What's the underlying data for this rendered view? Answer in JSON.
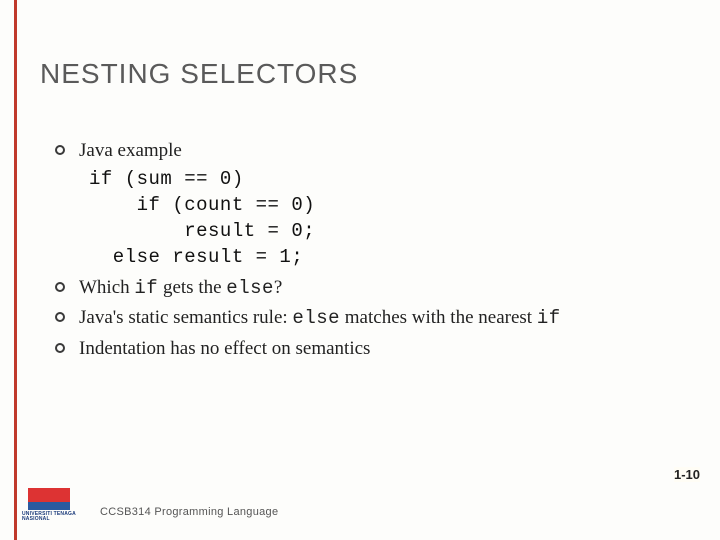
{
  "title": "NESTING SELECTORS",
  "bullets": {
    "b1": "Java example",
    "code_lines": "if (sum == 0)\n    if (count == 0)\n        result = 0;\n  else result = 1;",
    "b2_prefix": "Which ",
    "b2_if": "if",
    "b2_mid": " gets the ",
    "b2_else": "else",
    "b2_suffix": "?",
    "b3_prefix": "Java's static semantics rule: ",
    "b3_else": "else",
    "b3_mid": " matches with the nearest ",
    "b3_if": "if",
    "b4": "Indentation has no effect on semantics"
  },
  "pagenum": "1-10",
  "footer": "CCSB314 Programming Language",
  "logo_text": "UNIVERSITI\nTENAGA\nNASIONAL"
}
